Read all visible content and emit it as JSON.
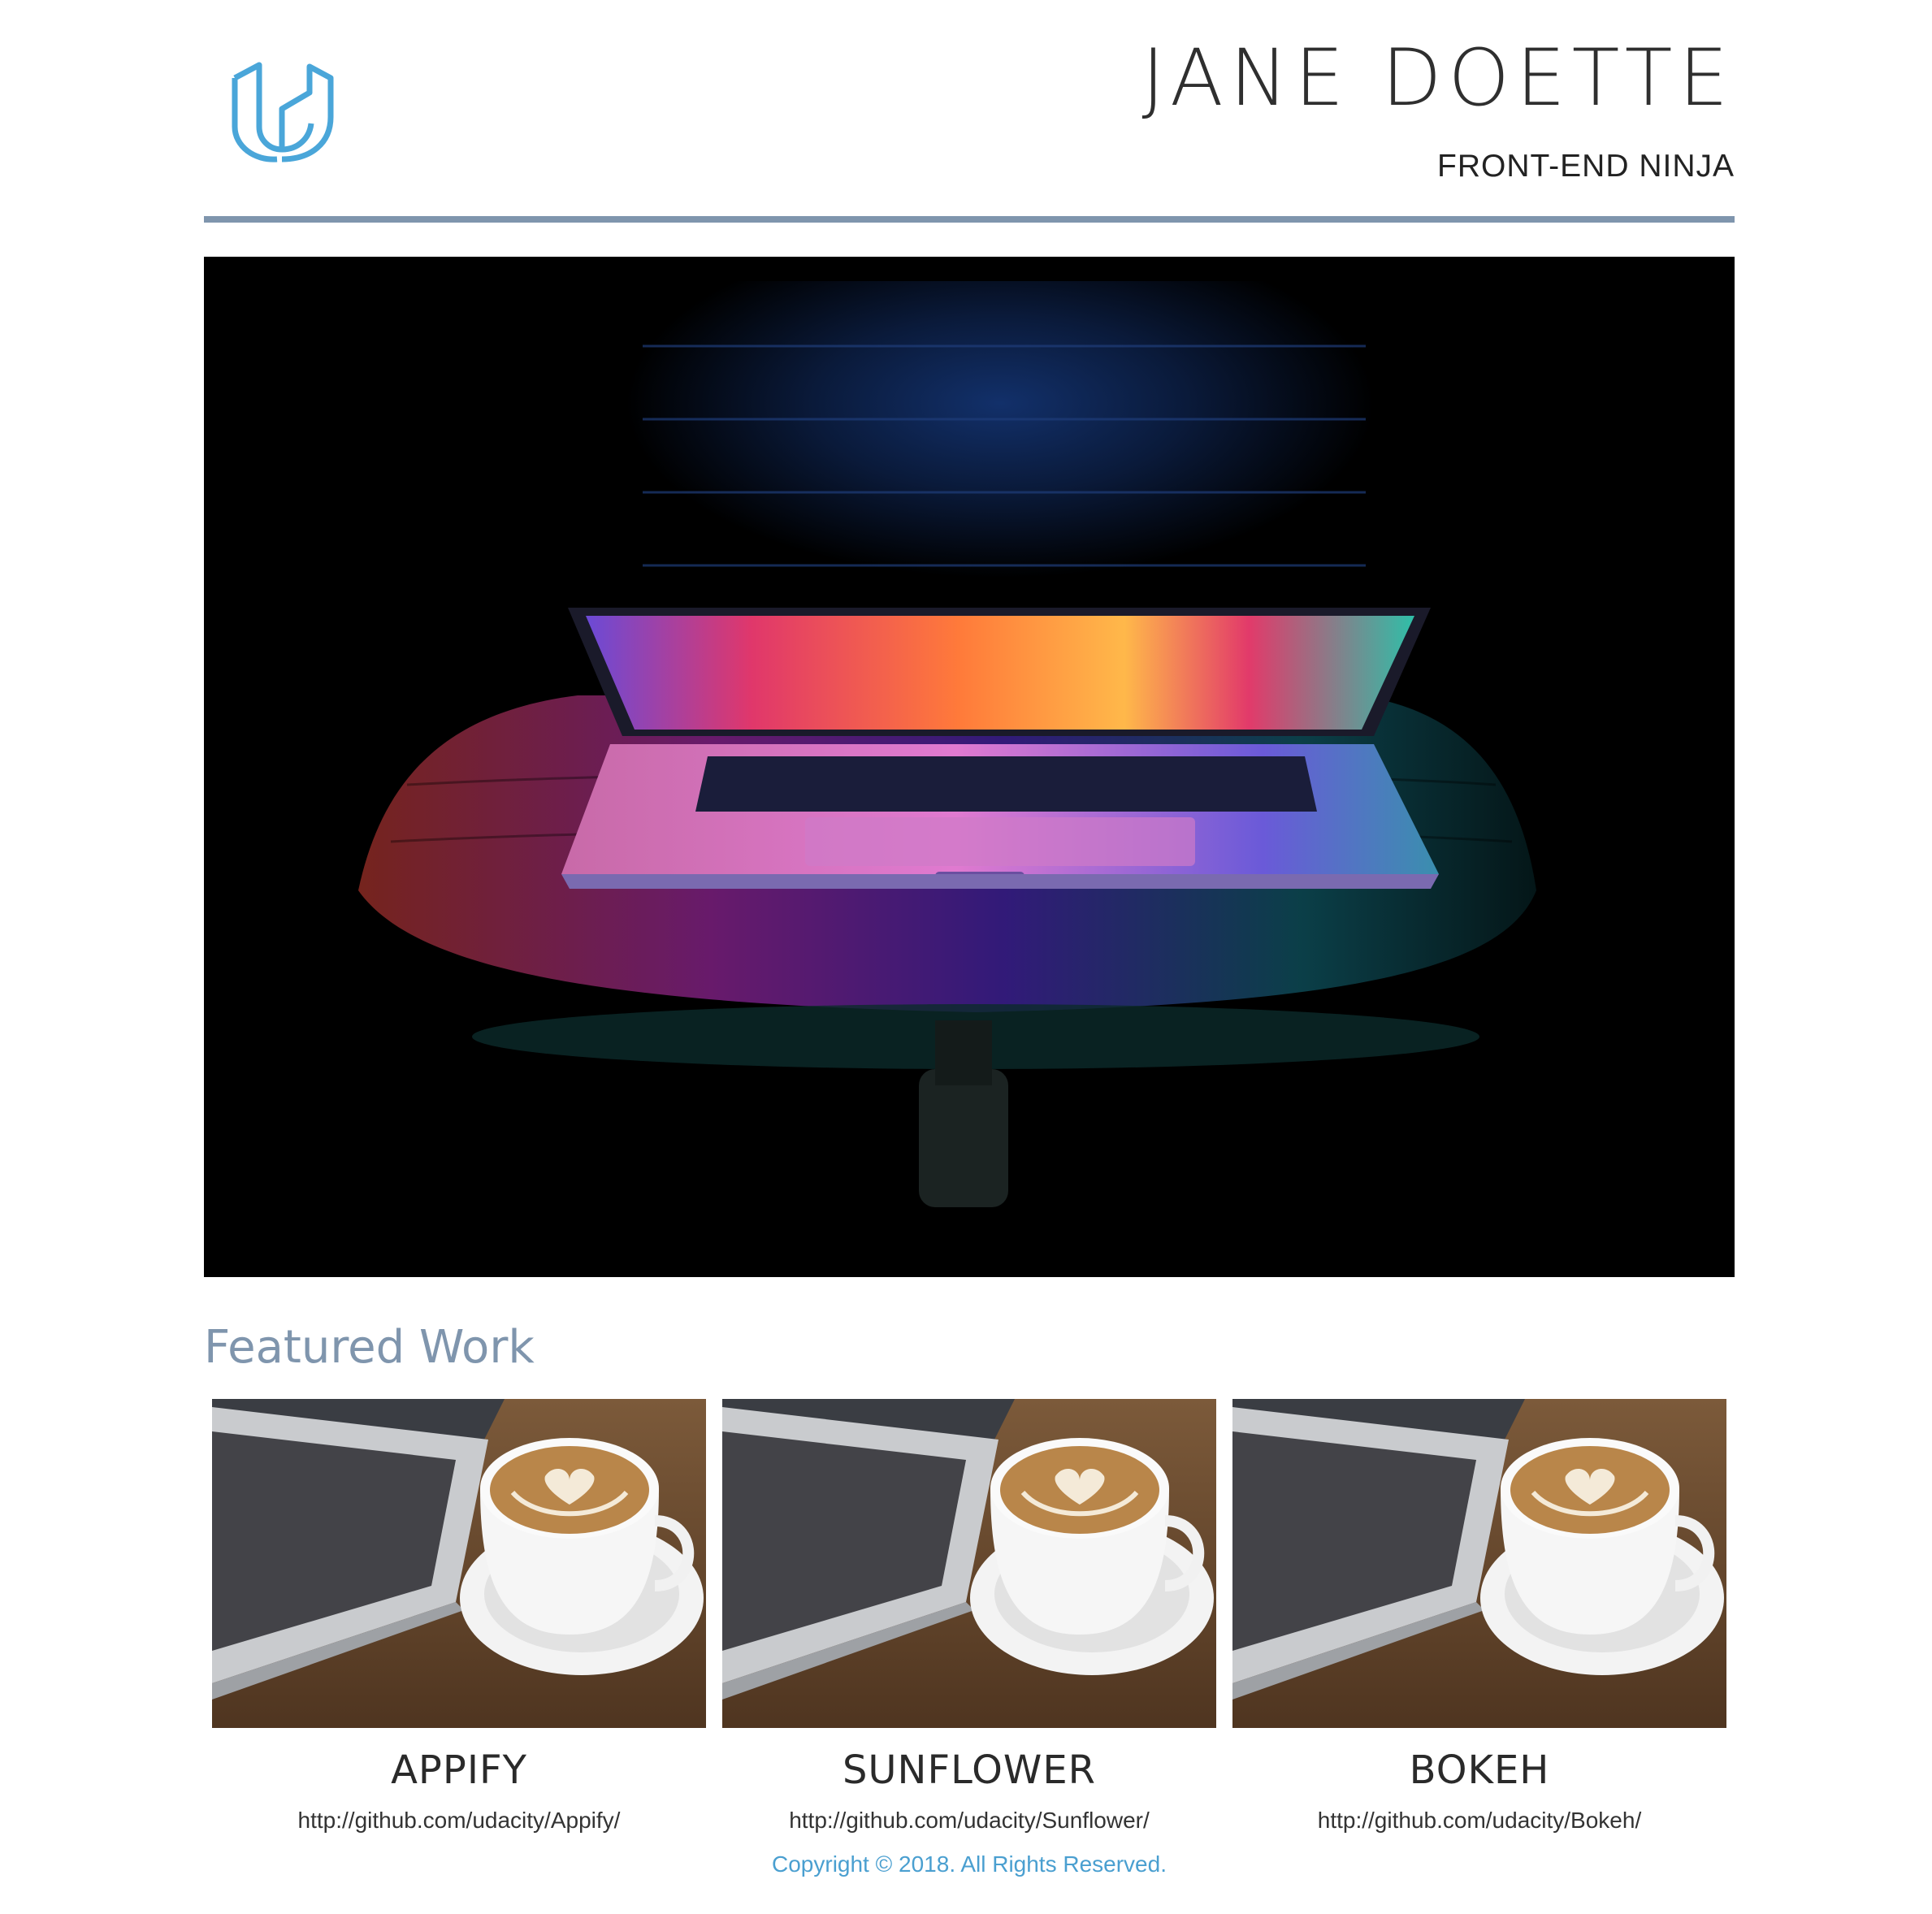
{
  "header": {
    "name": "JANE DOETTE",
    "role": "FRONT-END NINJA",
    "logo_icon": "udacity-logo-icon",
    "logo_color": "#4aa6d9",
    "divider_color": "#7f95ad"
  },
  "hero": {
    "image": "laptop-on-chair-neon-photo"
  },
  "featured": {
    "title": "Featured Work",
    "title_color": "#7f95ad",
    "items": [
      {
        "title": "APPIFY",
        "link": "http://github.com/udacity/Appify/",
        "image": "laptop-coffee-photo"
      },
      {
        "title": "SUNFLOWER",
        "link": "http://github.com/udacity/Sunflower/",
        "image": "laptop-coffee-photo"
      },
      {
        "title": "BOKEH",
        "link": "http://github.com/udacity/Bokeh/",
        "image": "laptop-coffee-photo"
      }
    ]
  },
  "footer": {
    "copyright": "Copyright © 2018. All Rights Reserved.",
    "color": "#4a9fd0"
  }
}
